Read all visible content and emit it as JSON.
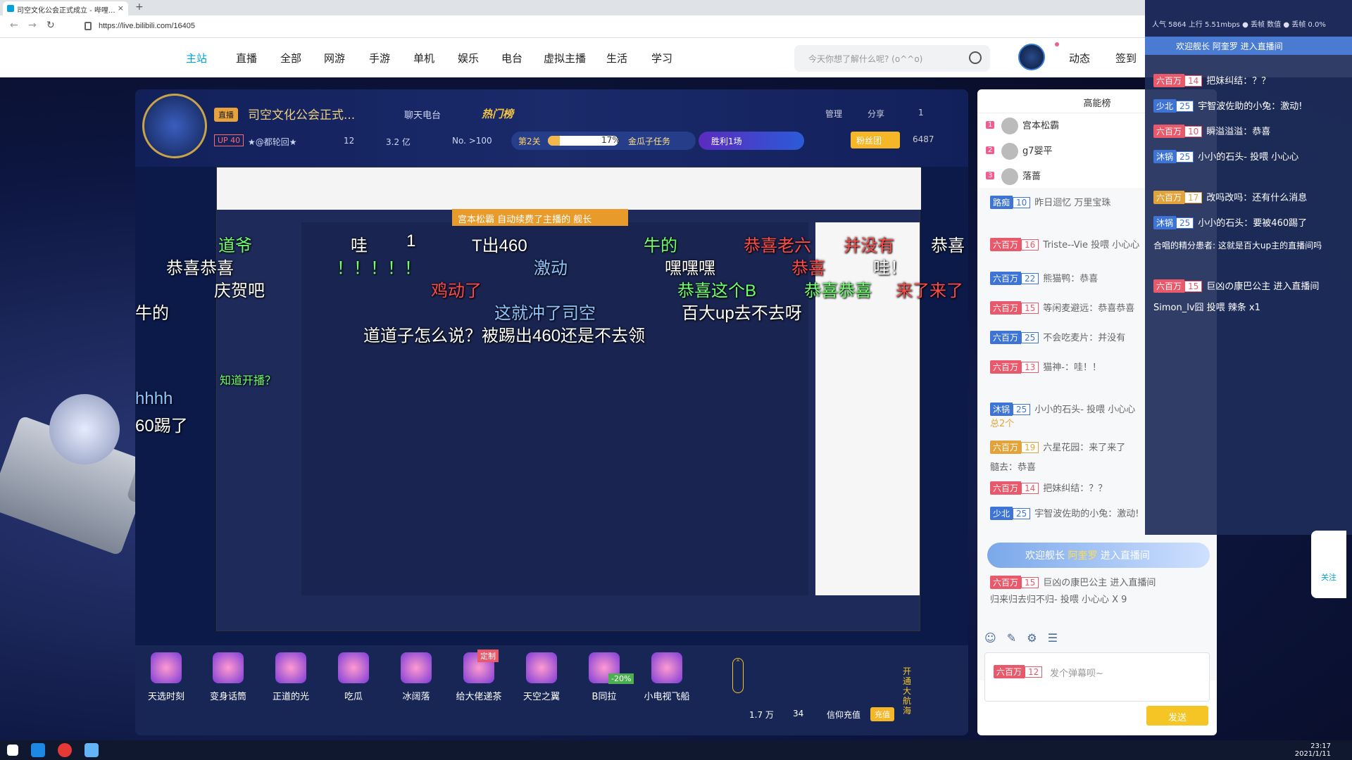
{
  "browser": {
    "tab_title": "司空文化公会正式成立 - 哔哩...",
    "url": "https://live.bilibili.com/16405"
  },
  "site_nav": {
    "items": [
      "主站",
      "直播",
      "全部",
      "网游",
      "手游",
      "单机",
      "娱乐",
      "电台",
      "虚拟主播",
      "生活",
      "学习"
    ],
    "search_placeholder": "今天你想了解什么呢? (o^^o)",
    "links": [
      "动态",
      "签到"
    ]
  },
  "player": {
    "live_tag": "直播",
    "title": "司空文化公会正式...",
    "category": "聊天电台",
    "hot_rank": "热门榜",
    "tools": [
      "管理",
      "分享",
      "1"
    ],
    "up_level": "UP 40",
    "streamer_name": "★@都轮回★",
    "stat_a": "12",
    "stat_b": "3.2 亿",
    "rank": "No. >100",
    "progress": {
      "stage": "第2关",
      "percent": 17,
      "percent_label": "17%",
      "task": "金瓜子任务"
    },
    "win": "胜利1场",
    "fans_btn": "粉丝团",
    "fans_count": "6487",
    "gold_banner": "宫本松霸 自动续费了主播的 舰长",
    "danmaku": [
      {
        "text": "道爷",
        "c": "green"
      },
      {
        "text": "哇",
        "c": ""
      },
      {
        "text": "1",
        "c": ""
      },
      {
        "text": "T出460",
        "c": ""
      },
      {
        "text": "牛的",
        "c": "green"
      },
      {
        "text": "恭喜老六",
        "c": "red"
      },
      {
        "text": "并没有",
        "c": "red"
      },
      {
        "text": "恭喜",
        "c": ""
      },
      {
        "text": "恭喜恭喜",
        "c": ""
      },
      {
        "text": "！！！！！",
        "c": "green"
      },
      {
        "text": "激动",
        "c": "blue"
      },
      {
        "text": "嘿嘿嘿",
        "c": ""
      },
      {
        "text": "恭喜",
        "c": "red"
      },
      {
        "text": "哇！",
        "c": ""
      },
      {
        "text": "庆贺吧",
        "c": ""
      },
      {
        "text": "鸡动了",
        "c": "red"
      },
      {
        "text": "恭喜这个B",
        "c": "green"
      },
      {
        "text": "恭喜恭喜",
        "c": "green"
      },
      {
        "text": "来了来了",
        "c": "red"
      },
      {
        "text": "牛的",
        "c": ""
      },
      {
        "text": "这就冲了司空",
        "c": "blue"
      },
      {
        "text": "百大up去不去呀",
        "c": ""
      },
      {
        "text": "道道子怎么说？被踢出460还是不去领",
        "c": ""
      },
      {
        "text": "知道开播？",
        "c": "green"
      },
      {
        "text": "hhhh",
        "c": "blue"
      },
      {
        "text": "60踢了",
        "c": ""
      }
    ],
    "gifts": [
      "天选时刻",
      "变身话筒",
      "正道的光",
      "吃瓜",
      "冰阔落",
      "给大佬递茶",
      "天空之翼",
      "B同拉",
      "小电视飞船"
    ],
    "gift_badge": "定制",
    "gift_discount": "-20%",
    "wallet_gold": "1.7 万",
    "wallet_silver": "34",
    "recharge": "信仰充值",
    "recharge_btn": "充值",
    "open_fleet": "开通大航海"
  },
  "chat": {
    "tab": "高能榜",
    "rank": [
      {
        "n": "1",
        "name": "宫本松霸"
      },
      {
        "n": "2",
        "name": "g7婴平"
      },
      {
        "n": "3",
        "name": "落蔷"
      }
    ],
    "messages": [
      {
        "medal": "路痴",
        "lv": "10",
        "mc": "blue",
        "text": "昨日迴忆  万里宝珠"
      },
      {
        "medal": "六百万",
        "lv": "16",
        "mc": "",
        "text": "Triste--Vie 投喂 小心心"
      },
      {
        "medal": "六百万",
        "lv": "22",
        "mc": "blue",
        "text": "熊猫鸭：恭喜"
      },
      {
        "medal": "六百万",
        "lv": "15",
        "mc": "",
        "text": "等闲麦避远：恭喜恭喜"
      },
      {
        "medal": "六百万",
        "lv": "25",
        "mc": "blue",
        "text": "不会吃麦片：并没有"
      },
      {
        "medal": "六百万",
        "lv": "13",
        "mc": "",
        "text": "猫神-：哇！！"
      },
      {
        "medal": "沐锅",
        "lv": "25",
        "mc": "blue",
        "text": "小小的石头- 投喂 小心心"
      },
      {
        "medal": "六百万",
        "lv": "19",
        "mc": "gold",
        "text": "六星花园：来了来了"
      },
      {
        "medal": "六百万",
        "lv": "14",
        "mc": "",
        "text": "把妹纠结：？？"
      },
      {
        "medal": "少北",
        "lv": "25",
        "mc": "blue",
        "text": "宇智波佐助的小兔：激动!"
      },
      {
        "medal": "六百万",
        "lv": "15",
        "mc": "",
        "text": "巨凶の康巴公主 进入直播间"
      }
    ],
    "extra_line_1": "总2个",
    "extra_line_2": "髓去：恭喜",
    "extra_line_3": "归来归去归不归- 投喂 小心心 X 9",
    "welcome_prefix": "欢迎舰长",
    "welcome_name": "阿奎罗",
    "welcome_suffix": "进入直播间",
    "input_medal": "六百万",
    "input_lv": "12",
    "input_placeholder": "发个弹幕呗~",
    "send": "发送"
  },
  "overlay": {
    "stats": "人气 5864  上行 5.51mbps  ● 丢帧 数值  ● 丢帧 0.0%",
    "welcome": "欢迎舰长 阿奎罗 进入直播间",
    "messages": [
      {
        "medal": "六百万",
        "lv": "14",
        "mc": "",
        "text": "把妹纠结：？？"
      },
      {
        "medal": "少北",
        "lv": "25",
        "mc": "blue",
        "text": "宇智波佐助的小兔：激动!"
      },
      {
        "medal": "六百万",
        "lv": "10",
        "mc": "",
        "text": "瞬溢溢溢：恭喜"
      },
      {
        "medal": "沐锅",
        "lv": "25",
        "mc": "blue",
        "text": "小小的石头- 投喂 小心心"
      },
      {
        "medal": "六百万",
        "lv": "17",
        "mc": "gold",
        "text": "改吗改吗：还有什么消息"
      },
      {
        "medal": "沐锅",
        "lv": "25",
        "mc": "blue",
        "text": "小小的石头：要被460踢了"
      },
      {
        "medal": "六百万",
        "lv": "15",
        "mc": "",
        "text": "巨凶の康巴公主 进入直播间"
      }
    ],
    "extra": "合唱的精分患者: 这就是百大up主的直播间吗",
    "gift_line": "Simon_lv囧 投喂 辣条 x1",
    "follow": "关注"
  },
  "taskbar": {
    "time": "23:17",
    "date": "2021/1/11"
  }
}
